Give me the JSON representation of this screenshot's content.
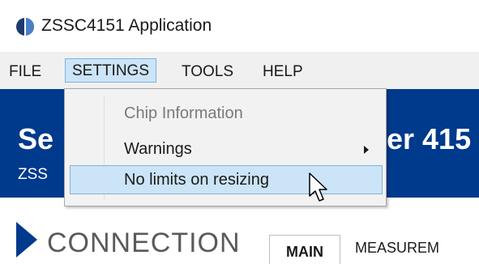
{
  "window": {
    "title": "ZSSC4151 Application",
    "icon": "app-logo-icon"
  },
  "menubar": {
    "items": [
      "FILE",
      "SETTINGS",
      "TOOLS",
      "HELP"
    ],
    "active": "SETTINGS"
  },
  "banner": {
    "title_left": "Se",
    "title_right": "er 415",
    "subtitle": "ZSS",
    "color": "#003a8c"
  },
  "settings_menu": {
    "items": [
      {
        "label": "Chip Information",
        "state": "disabled"
      },
      {
        "label": "Warnings",
        "state": "normal",
        "has_submenu": true
      },
      {
        "label": "No limits on resizing",
        "state": "hovered"
      }
    ]
  },
  "lower": {
    "connection_label": "CONNECTION",
    "tabs": [
      "MAIN",
      "MEASUREM"
    ],
    "active_tab": "MAIN"
  },
  "colors": {
    "highlight": "#cce4f7",
    "highlight_border": "#7fb2dd",
    "menu_bg": "#f2f2f2",
    "menubar_bg": "#f0f0f0"
  }
}
